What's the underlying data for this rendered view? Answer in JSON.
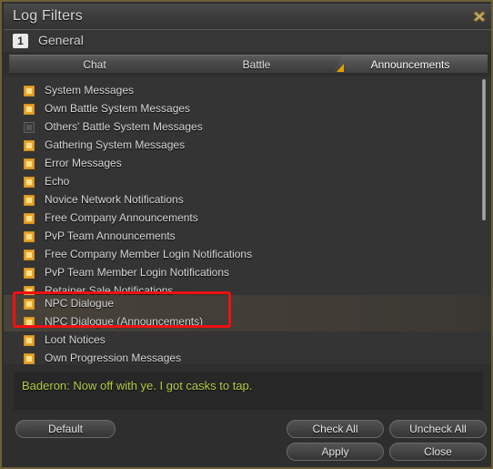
{
  "window": {
    "title": "Log Filters",
    "move_icon": "move-cross-icon",
    "accent_color": "#e0a100",
    "border_color": "#6d6038"
  },
  "subheader": {
    "number": "1",
    "label": "General"
  },
  "tabs": [
    {
      "label": "Chat",
      "active": false
    },
    {
      "label": "Battle",
      "active": false
    },
    {
      "label": "Announcements",
      "active": true
    }
  ],
  "filter_list": [
    {
      "label": "System Messages",
      "checked": true
    },
    {
      "label": "Own Battle System Messages",
      "checked": true
    },
    {
      "label": "Others' Battle System Messages",
      "checked": false
    },
    {
      "label": "Gathering System Messages",
      "checked": true
    },
    {
      "label": "Error Messages",
      "checked": true
    },
    {
      "label": "Echo",
      "checked": true
    },
    {
      "label": "Novice Network Notifications",
      "checked": true
    },
    {
      "label": "Free Company Announcements",
      "checked": true
    },
    {
      "label": "PvP Team Announcements",
      "checked": true
    },
    {
      "label": "Free Company Member Login Notifications",
      "checked": true
    },
    {
      "label": "PvP Team Member Login Notifications",
      "checked": true
    },
    {
      "label": "Retainer Sale Notifications",
      "checked": true
    },
    {
      "label": "NPC Dialogue",
      "checked": true,
      "highlighted": true
    },
    {
      "label": "NPC Dialogue (Announcements)",
      "checked": true,
      "highlighted": true
    },
    {
      "label": "Loot Notices",
      "checked": true
    },
    {
      "label": "Own Progression Messages",
      "checked": true
    }
  ],
  "preview": {
    "text": "Baderon: Now off with ye. I got casks to tap.",
    "text_color": "#b4d04a"
  },
  "footer": {
    "default_label": "Default",
    "check_all_label": "Check All",
    "uncheck_all_label": "Uncheck All",
    "apply_label": "Apply",
    "close_label": "Close"
  },
  "annotation": {
    "color": "#ee1111",
    "targets": [
      "NPC Dialogue",
      "NPC Dialogue (Announcements)"
    ]
  }
}
